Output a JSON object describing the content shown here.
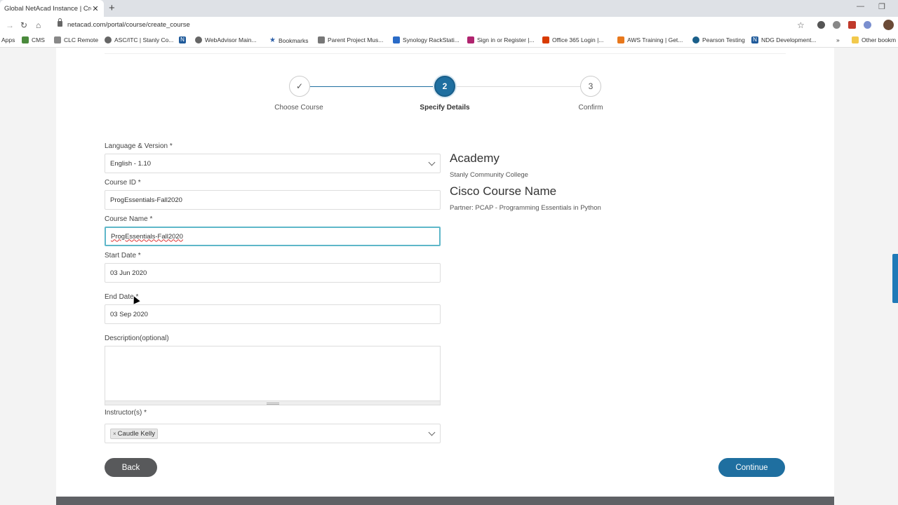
{
  "browser": {
    "tab_title": "Global NetAcad Instance | Create",
    "tab_close": "✕",
    "new_tab": "+",
    "url": "netacad.com/portal/course/create_course",
    "window_minimize": "—",
    "window_restore": "❐"
  },
  "bookmarks": [
    {
      "label": "Apps",
      "icon": "apps-grid-icon"
    },
    {
      "label": "CMS",
      "icon": "cms-icon"
    },
    {
      "label": "CLC Remote",
      "icon": "remote-icon"
    },
    {
      "label": "ASC/ITC | Stanly Co...",
      "icon": "globe-icon"
    },
    {
      "label": "",
      "icon": "netacad-n-icon"
    },
    {
      "label": "WebAdvisor Main...",
      "icon": "globe-icon"
    },
    {
      "label": "Bookmarks",
      "icon": "star-icon"
    },
    {
      "label": "Parent Project Mus...",
      "icon": "site-icon"
    },
    {
      "label": "Synology RackStati...",
      "icon": "dsm-icon"
    },
    {
      "label": "Sign in or Register |...",
      "icon": "edx-icon"
    },
    {
      "label": "Office 365 Login |...",
      "icon": "office-icon"
    },
    {
      "label": "AWS Training | Get...",
      "icon": "aws-icon"
    },
    {
      "label": "Pearson Testing",
      "icon": "pearson-icon"
    },
    {
      "label": "NDG Development...",
      "icon": "netacad-n-icon"
    },
    {
      "label": "»",
      "icon": ""
    },
    {
      "label": "Other bookm",
      "icon": "folder-icon"
    }
  ],
  "stepper": {
    "steps": [
      {
        "num": "✓",
        "label": "Choose Course"
      },
      {
        "num": "2",
        "label": "Specify Details"
      },
      {
        "num": "3",
        "label": "Confirm"
      }
    ]
  },
  "form": {
    "language_label": "Language & Version *",
    "language_value": "English - 1.10",
    "course_id_label": "Course ID *",
    "course_id_value": "ProgEssentials-Fall2020",
    "course_name_label": "Course Name *",
    "course_name_value": "ProgEssentials-Fall2020",
    "start_label": "Start Date *",
    "start_value": "03 Jun 2020",
    "end_label": "End Date *",
    "end_value": "03 Sep 2020",
    "description_label": "Description(optional)",
    "instructors_label": "Instructor(s) *",
    "instructor_chip": "Caudle Kelly",
    "chip_remove": "×"
  },
  "info": {
    "academy_heading": "Academy",
    "academy_value": "Stanly Community College",
    "course_heading": "Cisco Course Name",
    "course_value": "Partner: PCAP - Programming Essentials in Python"
  },
  "buttons": {
    "back": "Back",
    "continue": "Continue"
  },
  "colors": {
    "accent": "#1f6fa0",
    "focus": "#5eb7c9",
    "back_button": "#58595b"
  }
}
